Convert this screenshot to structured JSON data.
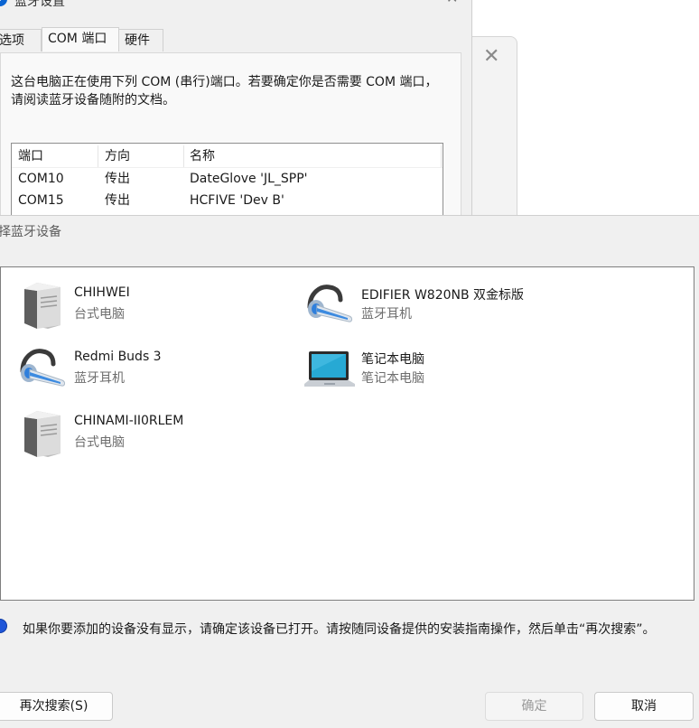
{
  "back_window": {
    "title": "蓝牙设置",
    "tabs": [
      "选项",
      "COM 端口",
      "硬件"
    ],
    "description": "这台电脑正在使用下列 COM (串行)端口。若要确定你是否需要 COM 端口，请阅读蓝牙设备随附的文档。",
    "table": {
      "headers": [
        "端口",
        "方向",
        "名称"
      ],
      "rows": [
        [
          "COM10",
          "传出",
          "DateGlove 'JL_SPP'"
        ],
        [
          "COM15",
          "传出",
          "HCFIVE 'Dev B'"
        ]
      ]
    }
  },
  "dialog": {
    "title": "择蓝牙设备",
    "devices": [
      {
        "name": "CHIHWEI",
        "type": "台式电脑",
        "icon": "desktop-tower-icon"
      },
      {
        "name": "EDIFIER W820NB 双金标版",
        "type": "蓝牙耳机",
        "icon": "bluetooth-headset-icon"
      },
      {
        "name": "Redmi Buds 3",
        "type": "蓝牙耳机",
        "icon": "bluetooth-headset-icon"
      },
      {
        "name": "笔记本电脑",
        "type": "笔记本电脑",
        "icon": "laptop-icon"
      },
      {
        "name": "CHINAMI-II0RLEM",
        "type": "台式电脑",
        "icon": "desktop-tower-icon"
      }
    ],
    "info_text": "如果你要添加的设备没有显示，请确定该设备已打开。请按随同设备提供的安装指南操作，然后单击“再次搜索”。",
    "buttons": {
      "search_again": "再次搜索(S)",
      "ok": "确定",
      "cancel": "取消"
    }
  },
  "colors": {
    "accent": "#1f56d8",
    "dialog_bg": "#f0f0f0",
    "list_bg": "#ffffff"
  }
}
